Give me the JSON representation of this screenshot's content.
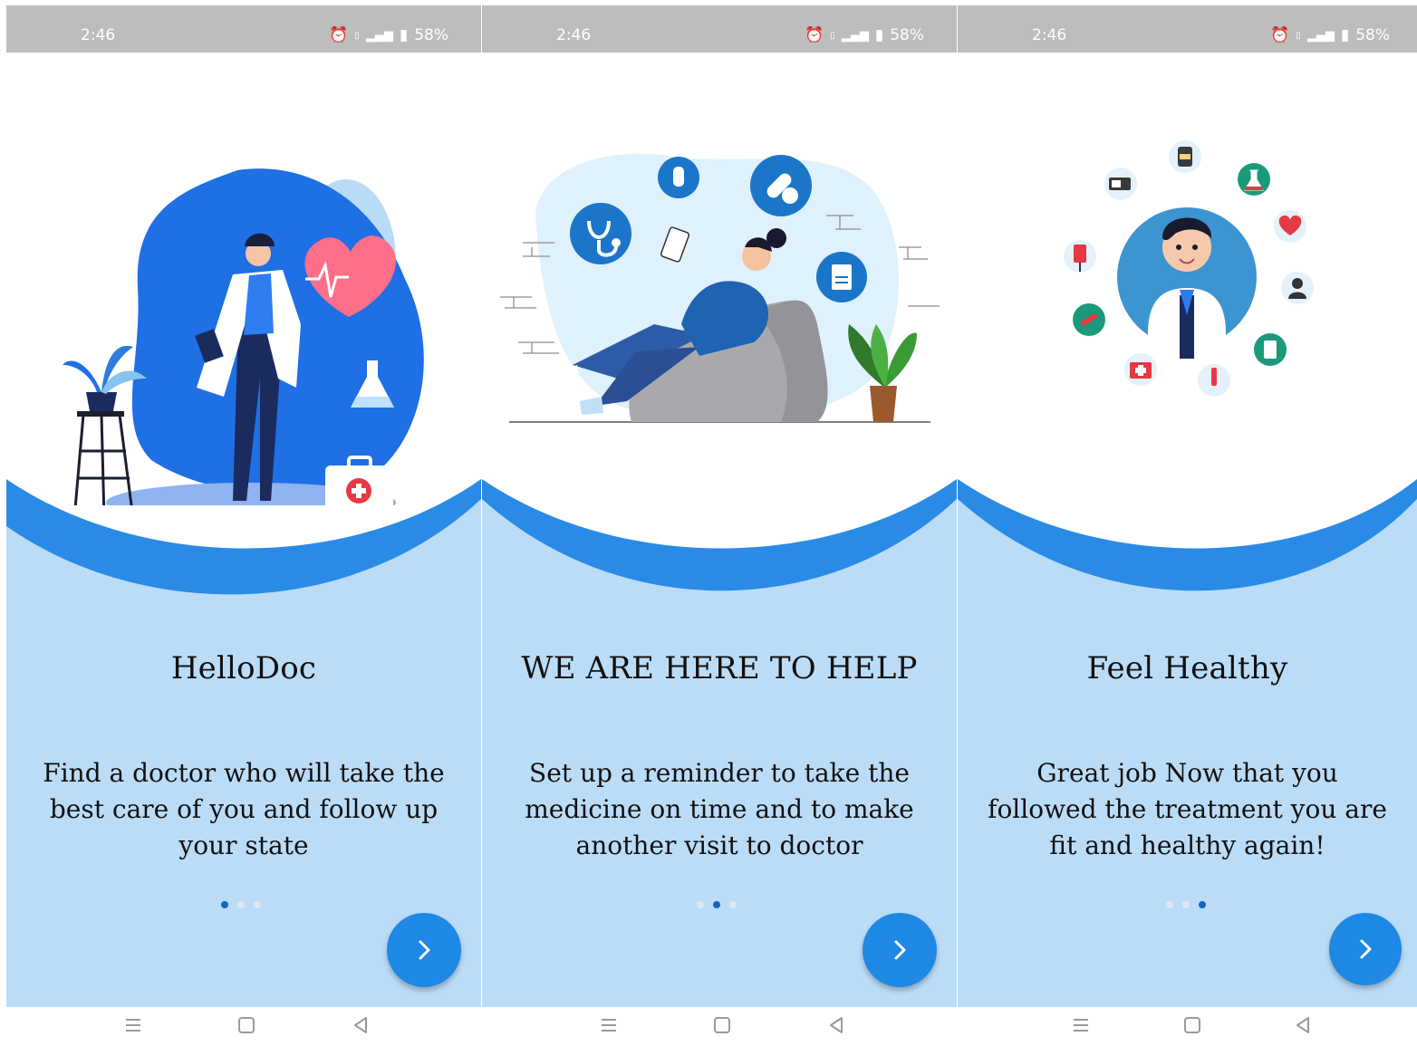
{
  "status": {
    "time": "2:46",
    "battery": "58%",
    "icons": [
      "alarm-icon",
      "volte-icon",
      "signal-4g-icon",
      "battery-icon"
    ]
  },
  "colors": {
    "accent": "#1e88e5",
    "wave_dark": "#2a8be6",
    "wave_light": "#bbdcf7",
    "dot_active": "#1565c0",
    "dot_inactive": "#dbe9f7"
  },
  "screens": [
    {
      "title": "HelloDoc",
      "description": "Find a doctor who will take the best care of you and follow up your state",
      "illustration": "doctor-heart-illustration",
      "page_indicator": {
        "active": 1,
        "total": 3
      }
    },
    {
      "title": "WE ARE HERE TO HELP",
      "description": "Set up a reminder to take the medicine on time and to make another visit to doctor",
      "illustration": "woman-beanbag-phone-illustration",
      "page_indicator": {
        "active": 2,
        "total": 3
      }
    },
    {
      "title": "Feel Healthy",
      "description": "Great job Now that you followed the treatment you are fit and healthy again!",
      "illustration": "doctor-medical-icons-illustration",
      "page_indicator": {
        "active": 3,
        "total": 3
      }
    }
  ],
  "navbar": {
    "icons": [
      "menu-icon",
      "home-square-icon",
      "back-triangle-icon"
    ]
  }
}
